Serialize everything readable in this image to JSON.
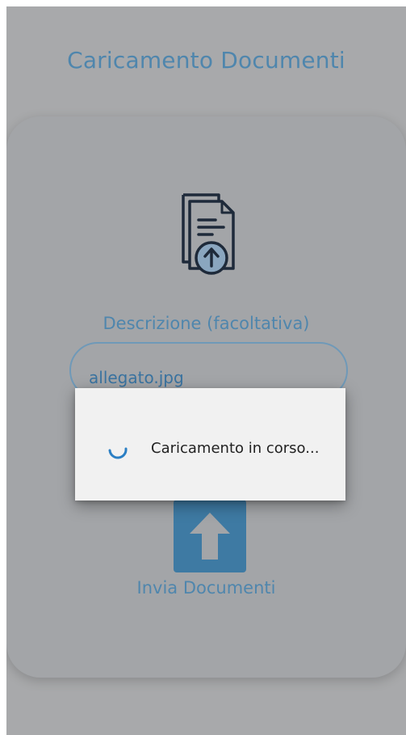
{
  "header": {
    "title": "Caricamento Documenti"
  },
  "form": {
    "description_label": "Descrizione (facoltativa)",
    "description_value": "allegato.jpg",
    "submit_label": "Invia Documenti"
  },
  "dialog": {
    "message": "Caricamento in corso..."
  },
  "icons": {
    "document": "document-upload-icon",
    "upload": "upload-arrow-icon",
    "spinner": "loading-spinner-icon"
  },
  "colors": {
    "accent": "#4f86ad",
    "button": "#3e7aa3",
    "overlay_background": "#a8a9ab",
    "dialog_background": "#f1f1f1"
  }
}
